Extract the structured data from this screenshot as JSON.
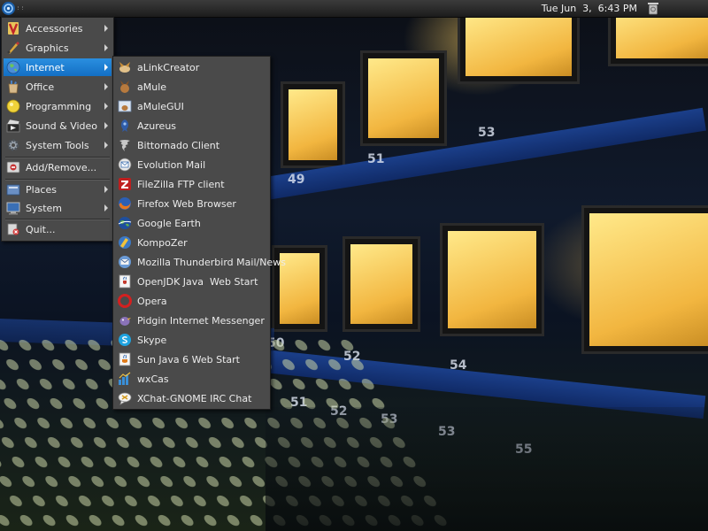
{
  "panel": {
    "clock": "Tue Jun  3,  6:43 PM",
    "launcher_icon": "distro-swirl-icon",
    "trash_icon": "trash-icon"
  },
  "wallpaper": {
    "labels": [
      "53",
      "51",
      "49",
      "50",
      "52",
      "54",
      "53",
      "51",
      "52",
      "53",
      "55"
    ]
  },
  "main_menu": {
    "items": [
      {
        "label": "Accessories",
        "icon": "accessories-icon",
        "submenu": true
      },
      {
        "label": "Graphics",
        "icon": "graphics-icon",
        "submenu": true
      },
      {
        "label": "Internet",
        "icon": "internet-globe-icon",
        "submenu": true,
        "active": true
      },
      {
        "label": "Office",
        "icon": "office-icon",
        "submenu": true
      },
      {
        "label": "Programming",
        "icon": "programming-icon",
        "submenu": true
      },
      {
        "label": "Sound & Video",
        "icon": "sound-video-icon",
        "submenu": true
      },
      {
        "label": "System Tools",
        "icon": "system-tools-icon",
        "submenu": true
      },
      {
        "label": "Add/Remove...",
        "icon": "add-remove-icon",
        "submenu": false
      },
      {
        "label": "Places",
        "icon": "places-icon",
        "submenu": true
      },
      {
        "label": "System",
        "icon": "system-icon",
        "submenu": true
      },
      {
        "label": "Quit...",
        "icon": "quit-icon",
        "submenu": false
      }
    ]
  },
  "internet_menu": {
    "items": [
      {
        "label": "aLinkCreator",
        "icon": "alinkcreator-icon"
      },
      {
        "label": "aMule",
        "icon": "amule-icon"
      },
      {
        "label": "aMuleGUI",
        "icon": "amulegui-icon"
      },
      {
        "label": "Azureus",
        "icon": "azureus-icon"
      },
      {
        "label": "Bittornado Client",
        "icon": "bittornado-icon"
      },
      {
        "label": "Evolution Mail",
        "icon": "evolution-mail-icon"
      },
      {
        "label": "FileZilla FTP client",
        "icon": "filezilla-icon"
      },
      {
        "label": "Firefox Web Browser",
        "icon": "firefox-icon"
      },
      {
        "label": "Google Earth",
        "icon": "google-earth-icon"
      },
      {
        "label": "KompoZer",
        "icon": "kompozer-icon"
      },
      {
        "label": "Mozilla Thunderbird Mail/News",
        "icon": "thunderbird-icon"
      },
      {
        "label": "OpenJDK Java  Web Start",
        "icon": "openjdk-icon"
      },
      {
        "label": "Opera",
        "icon": "opera-icon"
      },
      {
        "label": "Pidgin Internet Messenger",
        "icon": "pidgin-icon"
      },
      {
        "label": "Skype",
        "icon": "skype-icon"
      },
      {
        "label": "Sun Java 6 Web Start",
        "icon": "sun-java-icon"
      },
      {
        "label": "wxCas",
        "icon": "wxcas-icon"
      },
      {
        "label": "XChat-GNOME IRC Chat",
        "icon": "xchat-icon"
      }
    ]
  }
}
